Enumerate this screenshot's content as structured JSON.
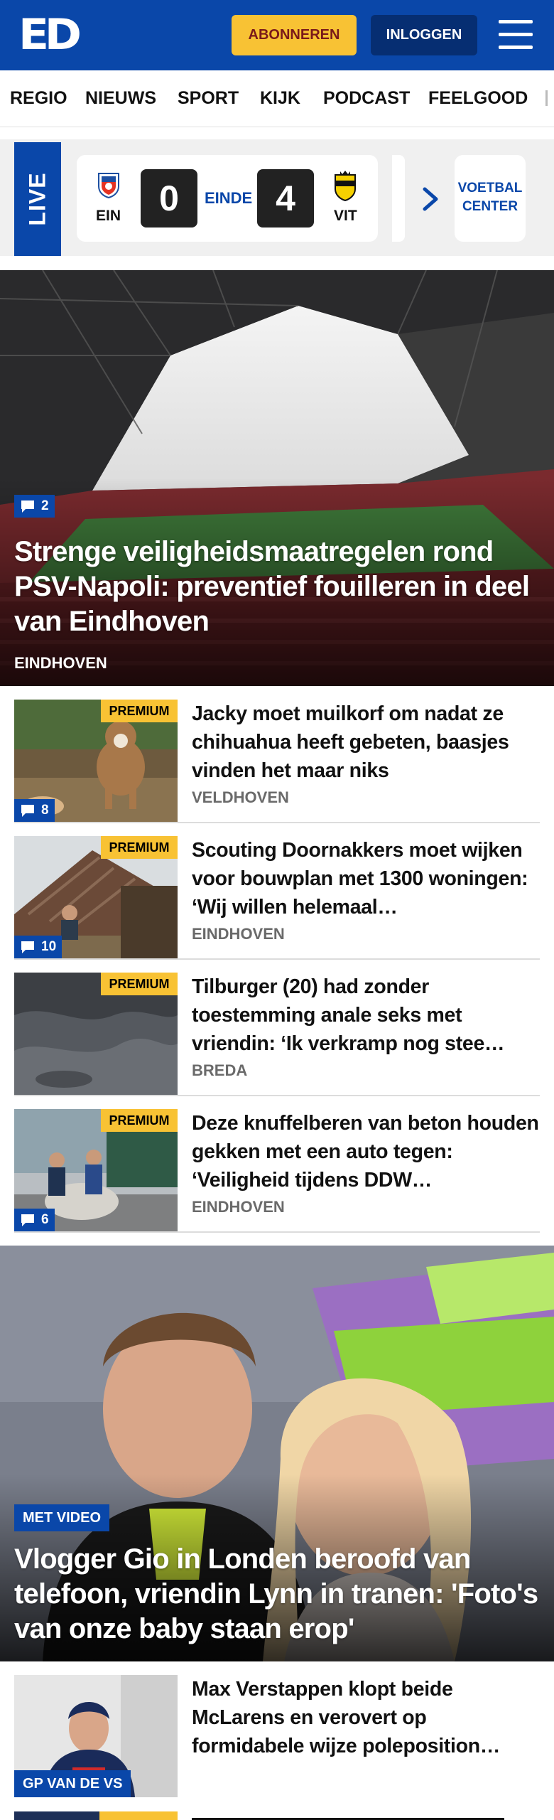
{
  "header": {
    "logo": "ED",
    "subscribe_label": "ABONNEREN",
    "login_label": "INLOGGEN",
    "menu_icon": "hamburger-menu-icon"
  },
  "nav": {
    "items": [
      "REGIO",
      "NIEUWS",
      "SPORT",
      "KIJK",
      "PODCAST",
      "FEELGOOD"
    ]
  },
  "live": {
    "label": "LIVE",
    "match": {
      "home_code": "EIN",
      "home_score": "0",
      "status": "EINDE",
      "away_score": "4",
      "away_code": "VIT"
    },
    "voetbal_center_line1": "VOETBAL",
    "voetbal_center_line2": "CENTER"
  },
  "hero": {
    "comments": "2",
    "title": "Strenge veiligheidsmaatregelen rond PSV-Napoli: preventief fouilleren in deel van Eindhoven",
    "location": "EINDHOVEN"
  },
  "articles": [
    {
      "premium": "PREMIUM",
      "comments": "8",
      "title": "Jacky moet muilkorf om nadat ze chihuahua heeft gebeten, baasjes vinden het maar niks",
      "location": "VELDHOVEN"
    },
    {
      "premium": "PREMIUM",
      "comments": "10",
      "title": "Scouting Doornakkers moet wijken voor bouwplan met 1300 woningen: ‘Wij willen helemaal…",
      "location": "EINDHOVEN"
    },
    {
      "premium": "PREMIUM",
      "title": "Tilburger (20) had zonder toestemming anale seks met vriendin: ‘Ik verkramp nog stee…",
      "location": "BREDA"
    },
    {
      "premium": "PREMIUM",
      "comments": "6",
      "title": "Deze knuffelberen van beton houden gekken met een auto tegen: ‘Veiligheid tijdens DDW…",
      "location": "EINDHOVEN"
    }
  ],
  "feature": {
    "badge": "MET VIDEO",
    "title": "Vlogger Gio in Londen beroofd van telefoon, vriendin Lynn in tranen: 'Foto's van onze baby staan erop'"
  },
  "bottom_article": {
    "badge": "GP VAN DE VS",
    "title": "Max Verstappen klopt beide McLarens en verovert op formidabele wijze poleposition…"
  },
  "colors": {
    "brand_blue": "#0a47a9",
    "premium_yellow": "#f8c234",
    "dark_navy": "#062e72"
  }
}
